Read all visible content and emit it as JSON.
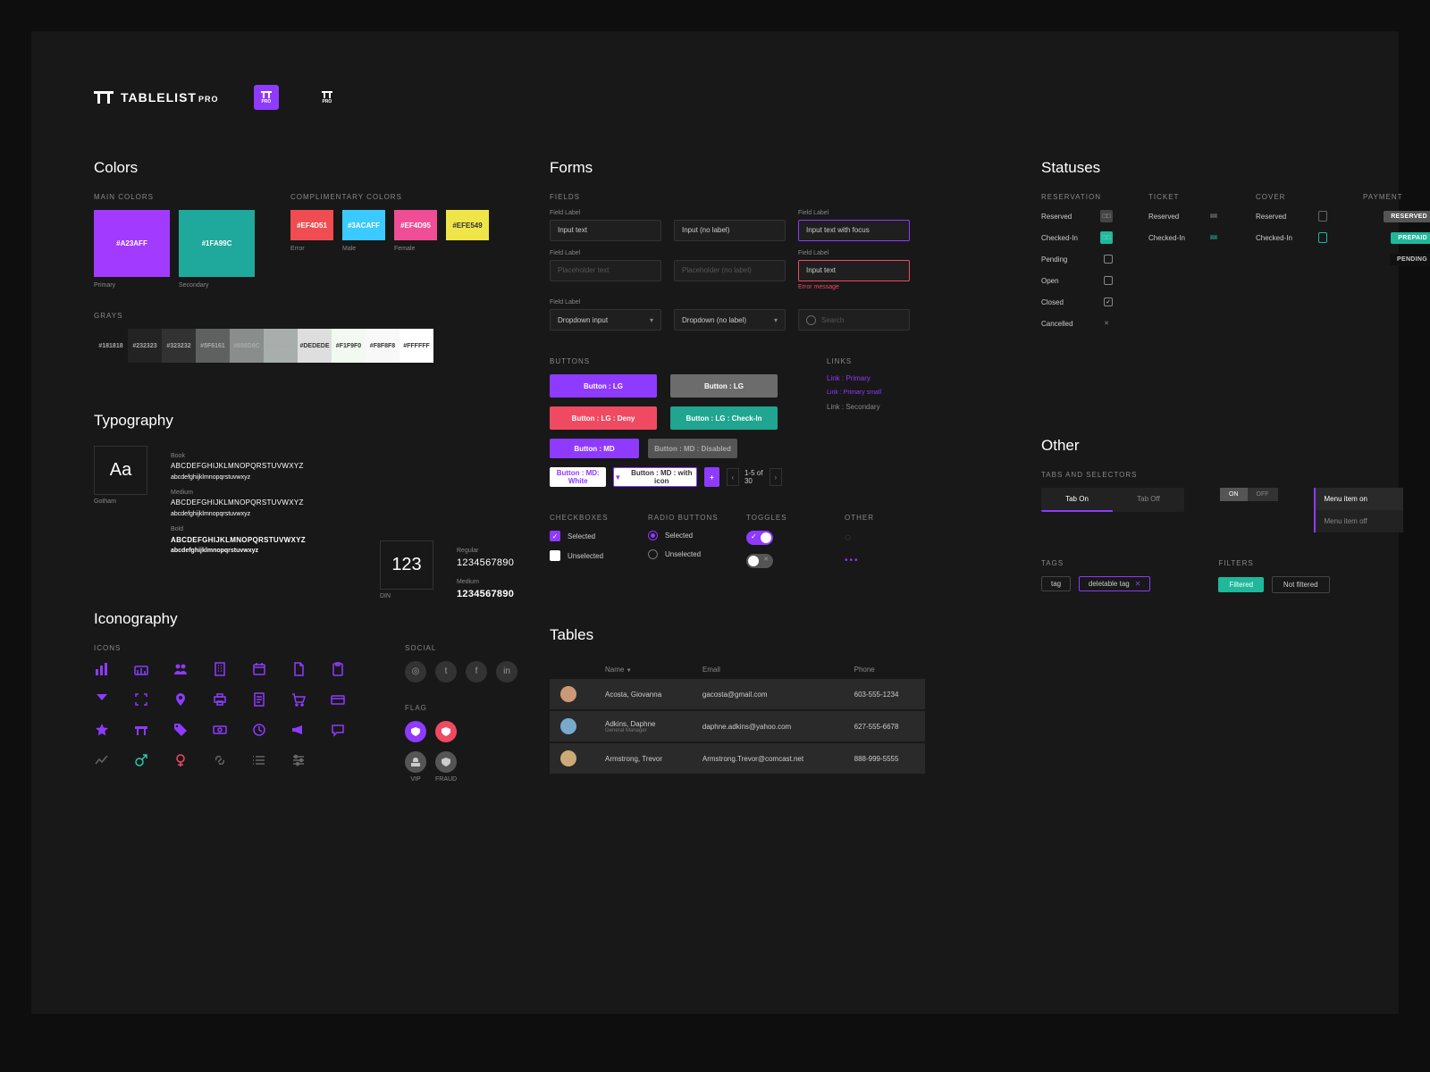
{
  "brand": {
    "name": "TABLELIST",
    "suffix": "PRO",
    "tile": "PRO"
  },
  "sections": {
    "colors": "Colors",
    "typography": "Typography",
    "iconography": "Iconography",
    "forms": "Forms",
    "tables": "Tables",
    "statuses": "Statuses",
    "other": "Other"
  },
  "colors": {
    "main_caption": "MAIN COLORS",
    "comp_caption": "COMPLIMENTARY COLORS",
    "grays_caption": "GRAYS",
    "main": [
      {
        "hex": "#A23AFF",
        "label": "Primary"
      },
      {
        "hex": "#1FA99C",
        "label": "Secondary"
      }
    ],
    "complimentary": [
      {
        "hex": "#EF4D51",
        "label": "Error"
      },
      {
        "hex": "#3ACAFF",
        "label": "Male"
      },
      {
        "hex": "#EF4D95",
        "label": "Female"
      },
      {
        "hex": "#EFE549",
        "label": ""
      }
    ],
    "grays": [
      "#181818",
      "#232323",
      "#323232",
      "#5F6161",
      "#898D8C",
      "#A7AEAC",
      "#DEDEDE",
      "#F1F9F0",
      "#F8F8F8",
      "#FFFFFF"
    ]
  },
  "typography": {
    "specimen_a": "Aa",
    "specimen_a_label": "Gotham",
    "specimen_n": "123",
    "specimen_n_label": "DIN",
    "weights": [
      "Book",
      "Medium",
      "Bold"
    ],
    "num_weights": [
      "Regular",
      "Medium"
    ],
    "upper": "ABCDEFGHIJKLMNOPQRSTUVWXYZ",
    "lower": "abcdefghijklmnopqrstuvwxyz",
    "digits": "1234567890"
  },
  "icons": {
    "caption": "ICONS",
    "social_caption": "SOCIAL",
    "flag_caption": "FLAG",
    "social": [
      "ig",
      "tw",
      "fb",
      "in"
    ],
    "flags": [
      {
        "name": "vip",
        "label": "VIP",
        "bg": "#8E3AFF"
      },
      {
        "name": "fraud",
        "label": "FRAUD",
        "bg": "#ef4a61"
      }
    ],
    "flags2": [
      {
        "bg": "#555"
      },
      {
        "bg": "#555"
      }
    ]
  },
  "forms": {
    "fields_caption": "FIELDS",
    "buttons_caption": "BUTTONS",
    "links_caption": "LINKS",
    "cb_caption": "CHECKBOXES",
    "rb_caption": "RADIO BUTTONS",
    "tg_caption": "TOGGLES",
    "other_caption": "OTHER",
    "label_text": "Field Label",
    "input_text": "Input text",
    "input_nolabel": "Input (no label)",
    "input_focus": "Input text with focus",
    "placeholder": "Placeholder text",
    "placeholder_nolabel": "Placeholder (no label)",
    "error_msg": "Error message",
    "dropdown": "Dropdown input",
    "dropdown_nolabel": "Dropdown (no label)",
    "search": "Search",
    "btn_lg": "Button : LG",
    "btn_lg_deny": "Button : LG : Deny",
    "btn_lg_checkin": "Button : LG : Check-In",
    "btn_md": "Button : MD",
    "btn_md_disabled": "Button : MD : Disabled",
    "btn_md_white": "Button : MD: White",
    "btn_md_icon": "Button : MD : with icon",
    "pager": "1-5 of 30",
    "link_primary": "Link : Primary",
    "link_primary_sm": "Link : Primary small",
    "link_secondary": "Link : Secondary",
    "selected": "Selected",
    "unselected": "Unselected"
  },
  "statuses": {
    "reservation": {
      "caption": "RESERVATION",
      "rows": [
        "Reserved",
        "Checked-In",
        "Pending",
        "Open",
        "Closed",
        "Cancelled"
      ]
    },
    "ticket": {
      "caption": "TICKET",
      "rows": [
        "Reserved",
        "Checked-In"
      ]
    },
    "cover": {
      "caption": "COVER",
      "rows": [
        "Reserved",
        "Checked-In"
      ]
    },
    "payment": {
      "caption": "PAYMENT",
      "rows": [
        {
          "label": "RESERVED",
          "bg": "#555"
        },
        {
          "label": "PREPAID",
          "bg": "#1fb89a"
        },
        {
          "label": "PENDING",
          "bg": "#111"
        }
      ]
    }
  },
  "other": {
    "tabs_caption": "TABS AND SELECTORS",
    "tags_caption": "TAGS",
    "filters_caption": "FILTERS",
    "tab_on": "Tab On",
    "tab_off": "Tab Off",
    "seg_on": "ON",
    "seg_off": "OFF",
    "menu_on": "Menu item on",
    "menu_off": "Menu item off",
    "tag": "tag",
    "deltag": "deletable tag",
    "filtered": "Filtered",
    "notfiltered": "Not filtered"
  },
  "table": {
    "headers": [
      "Name",
      "Email",
      "Phone"
    ],
    "rows": [
      {
        "name": "Acosta, Giovanna",
        "sub": "",
        "email": "gacosta@gmail.com",
        "phone": "603-555-1234",
        "av": "#c97"
      },
      {
        "name": "Adkins, Daphne",
        "sub": "General Manager",
        "email": "daphne.adkins@yahoo.com",
        "phone": "627-555-6678",
        "av": "#7ac"
      },
      {
        "name": "Armstrong, Trevor",
        "sub": "",
        "email": "Armstrong.Trevor@comcast.net",
        "phone": "888-999-5555",
        "av": "#ca7"
      }
    ]
  }
}
